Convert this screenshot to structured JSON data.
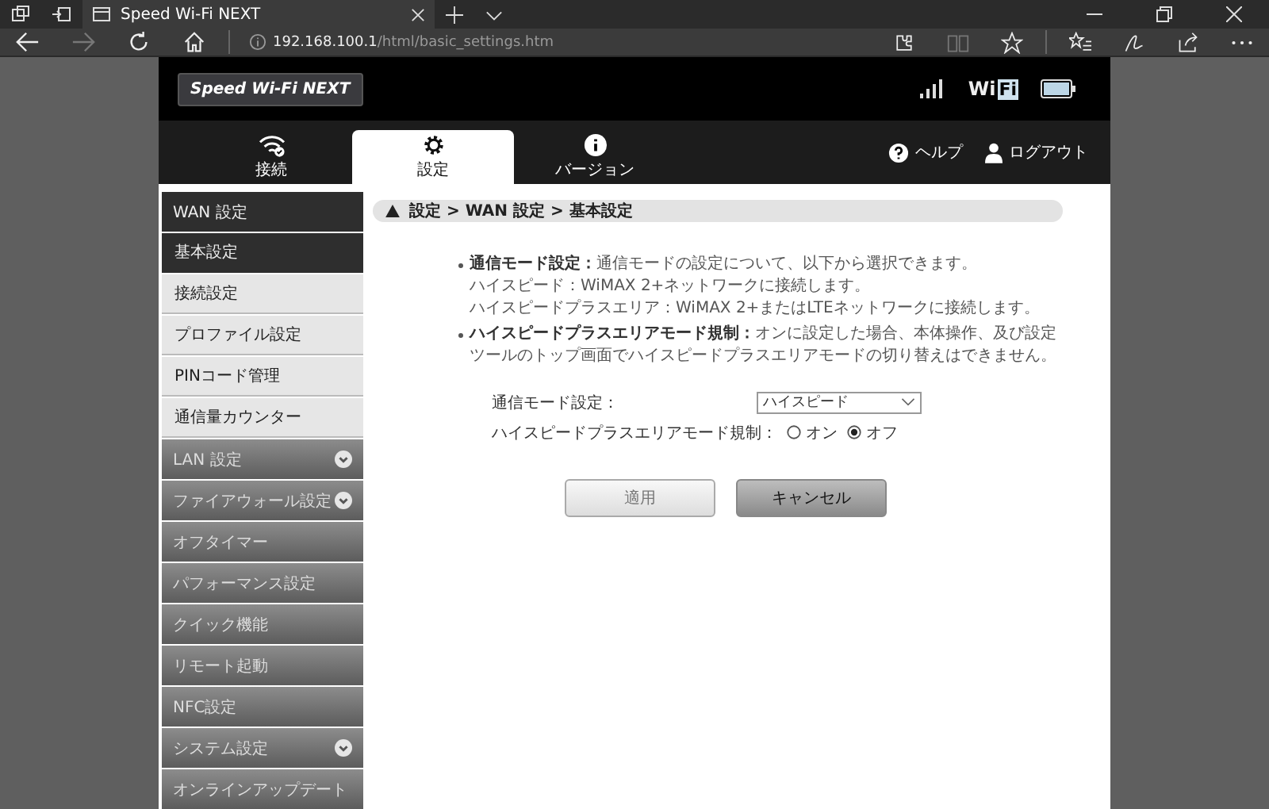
{
  "browser": {
    "tab_title": "Speed Wi-Fi NEXT",
    "url_host": "192.168.100.1",
    "url_path": "/html/basic_settings.htm"
  },
  "header": {
    "logo": "Speed Wi-Fi NEXT",
    "wifi_logo": [
      "Wi",
      "Fi"
    ]
  },
  "nav_tabs": [
    {
      "label": "接続",
      "kind": "wifi",
      "selected": false
    },
    {
      "label": "設定",
      "kind": "gear",
      "selected": true
    },
    {
      "label": "バージョン",
      "kind": "info",
      "selected": false
    }
  ],
  "header_links": [
    {
      "label": "ヘルプ",
      "kind": "help"
    },
    {
      "label": "ログアウト",
      "kind": "user"
    }
  ],
  "sidebar": {
    "items": [
      {
        "label": "WAN 設定",
        "kind": "group",
        "expanded": true,
        "children": [
          {
            "label": "基本設定",
            "selected": true
          },
          {
            "label": "接続設定",
            "selected": false
          },
          {
            "label": "プロファイル設定",
            "selected": false
          },
          {
            "label": "PINコード管理",
            "selected": false
          },
          {
            "label": "通信量カウンター",
            "selected": false
          }
        ]
      },
      {
        "label": "LAN 設定",
        "kind": "group",
        "expanded": false
      },
      {
        "label": "ファイアウォール設定",
        "kind": "group",
        "expanded": false
      },
      {
        "label": "オフタイマー",
        "kind": "link"
      },
      {
        "label": "パフォーマンス設定",
        "kind": "link"
      },
      {
        "label": "クイック機能",
        "kind": "link"
      },
      {
        "label": "リモート起動",
        "kind": "link"
      },
      {
        "label": "NFC設定",
        "kind": "link"
      },
      {
        "label": "システム設定",
        "kind": "group",
        "expanded": false
      },
      {
        "label": "オンラインアップデート",
        "kind": "link"
      }
    ]
  },
  "breadcrumb": "設定 > WAN 設定 > 基本設定",
  "notes": [
    {
      "lines": [
        "**通信モード設定：**通信モードの設定について、以下から選択できます。",
        "ハイスピード：WiMAX 2+ネットワークに接続します。",
        "ハイスピードプラスエリア：WiMAX 2+またはLTEネットワークに接続します。"
      ]
    },
    {
      "lines": [
        "**ハイスピードプラスエリアモード規制：**オンに設定した場合、本体操作、及び設定ツールのトップ画面でハイスピードプラスエリアモードの切り替えはできません。"
      ]
    }
  ],
  "form": {
    "mode": {
      "label": "通信モード設定：",
      "value": "ハイスピード"
    },
    "restriction": {
      "label": "ハイスピードプラスエリアモード規制：",
      "options": [
        {
          "label": "オン",
          "selected": false
        },
        {
          "label": "オフ",
          "selected": true
        }
      ]
    }
  },
  "buttons": [
    {
      "label": "適用",
      "disabled": true
    },
    {
      "label": "キャンセル",
      "disabled": false
    }
  ]
}
